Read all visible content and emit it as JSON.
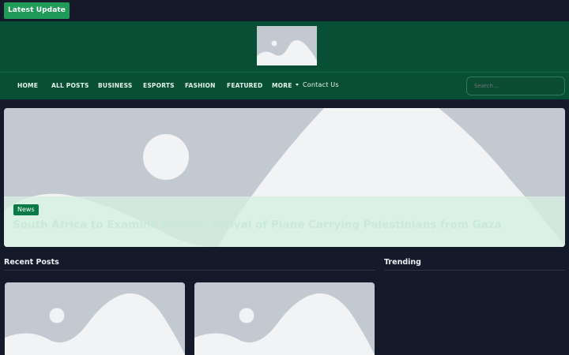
{
  "topbar": {
    "latest_label": "Latest  Update"
  },
  "nav": {
    "items": [
      "HOME",
      "ALL POSTS",
      "BUSINESS",
      "ESPORTS",
      "FASHION",
      "FEATURED",
      "MORE",
      "Contact Us"
    ]
  },
  "search": {
    "placeholder": "Search..."
  },
  "hero": {
    "badge": "News",
    "title": "South Africa to Examine Baffling Arrival of Plane Carrying Palestinians from Gaza"
  },
  "sections": {
    "recent": "Recent Posts",
    "trending": "Trending"
  },
  "colors": {
    "background": "#141a2a",
    "header": "#075036",
    "accent": "#1f9a57",
    "badge": "#087a45",
    "placeholder": "#c3c9d0"
  }
}
